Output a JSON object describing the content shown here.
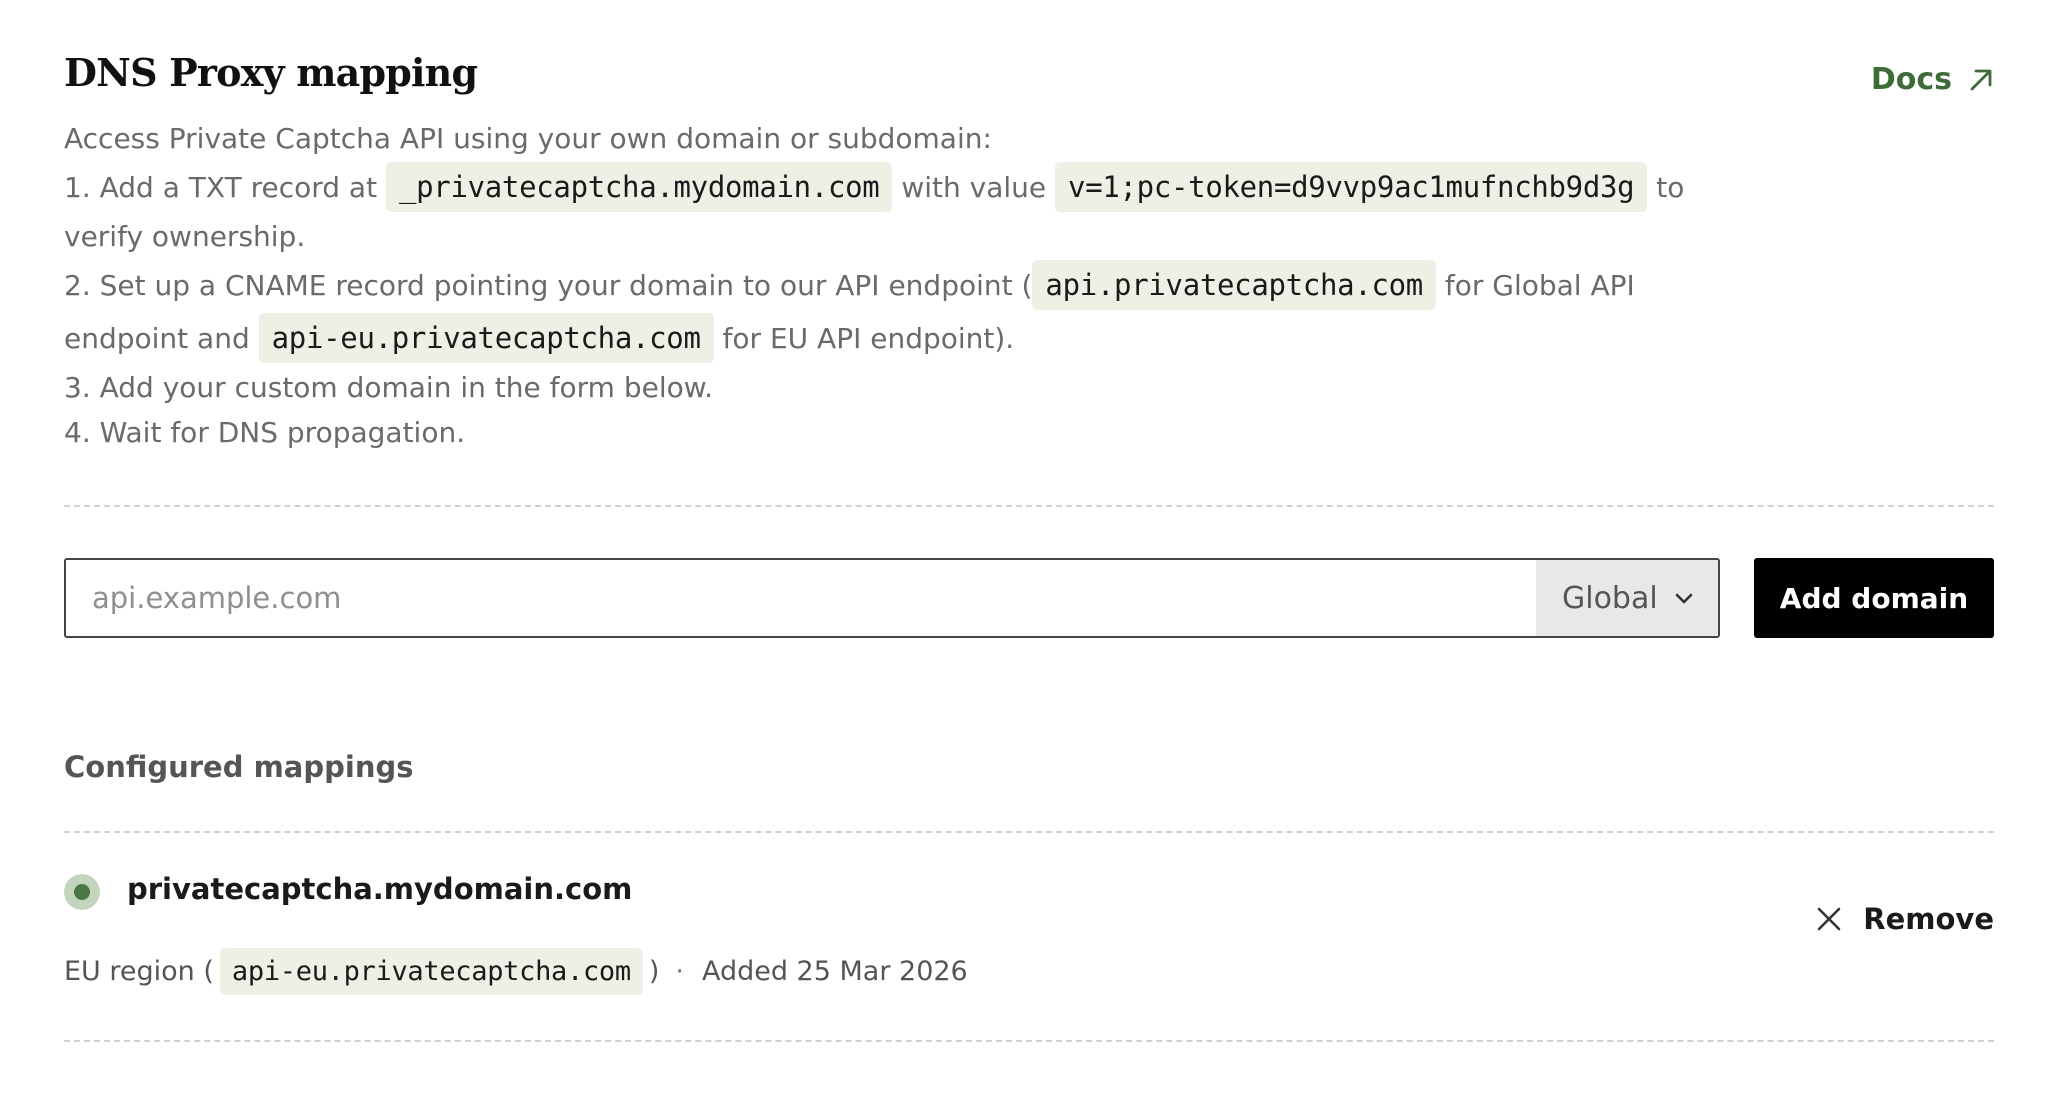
{
  "header": {
    "title": "DNS Proxy mapping",
    "docs_label": "Docs"
  },
  "instructions": {
    "intro": "Access Private Captcha API using your own domain or subdomain:",
    "step1_prefix": "1. Add a TXT record at",
    "step1_record": "_privatecaptcha.mydomain.com",
    "step1_mid": "with value",
    "step1_value": "v=1;pc-token=d9vvp9ac1mufnchb9d3g",
    "step1_suffix": "to",
    "step1_cont": "verify ownership.",
    "step2_prefix": "2. Set up a CNAME record pointing your domain to our API endpoint (",
    "step2_global": "api.privatecaptcha.com",
    "step2_mid": "for Global API",
    "step2_cont_prefix": "endpoint and",
    "step2_eu": "api-eu.privatecaptcha.com",
    "step2_suffix": "for EU API endpoint).",
    "step3": "3. Add your custom domain in the form below.",
    "step4": "4. Wait for DNS propagation."
  },
  "form": {
    "domain_placeholder": "api.example.com",
    "domain_value": "",
    "region_selected": "Global",
    "add_label": "Add domain"
  },
  "mappings": {
    "heading": "Configured mappings",
    "items": [
      {
        "domain": "privatecaptcha.mydomain.com",
        "status": "active",
        "status_color": "#4a7545",
        "region_label": "EU region (",
        "endpoint": "api-eu.privatecaptcha.com",
        "region_close": ")",
        "separator": "·",
        "added": "Added 25 Mar 2026",
        "remove_label": "Remove"
      }
    ]
  },
  "colors": {
    "accent": "#3f6b39",
    "code_bg": "#eef0e6",
    "button_bg": "#000000"
  },
  "icons": {
    "docs": "arrow-up-right-icon",
    "region": "chevron-down-icon",
    "remove": "close-icon",
    "status": "status-dot-icon"
  }
}
